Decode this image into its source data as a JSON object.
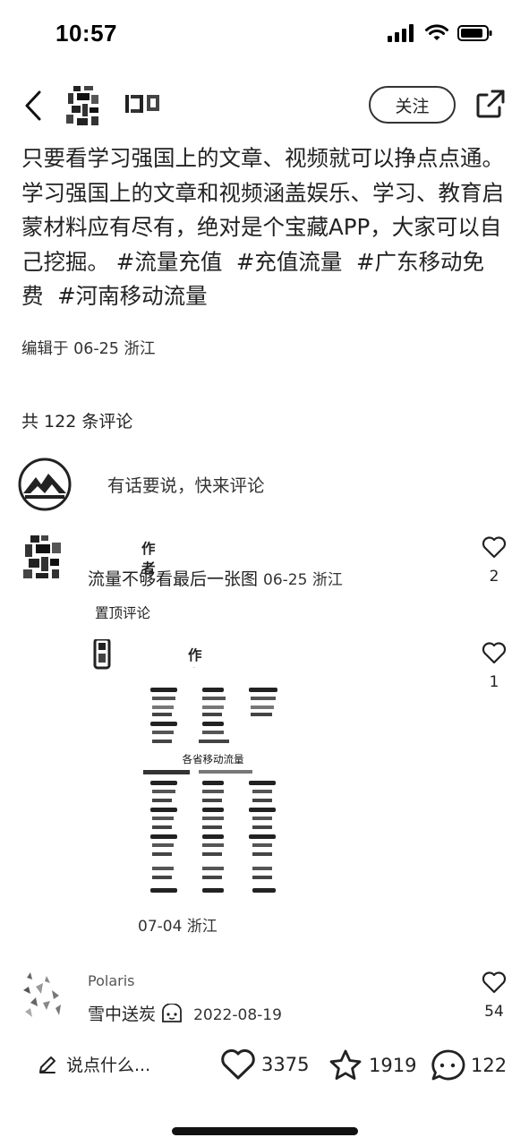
{
  "status": {
    "time": "10:57"
  },
  "nav": {
    "author_name": "",
    "follow_label": "关注"
  },
  "post": {
    "text": "只要看学习强国上的文章、视频就可以挣点点通。学习强国上的文章和视频涵盖娱乐、学习、教育启蒙材料应有尽有，绝对是个宝藏APP，大家可以自己挖掘。",
    "tags": [
      "#流量充值",
      "#充值流量",
      "#广东移动免费",
      "#河南移动流量"
    ],
    "edit_meta": "编辑于 06-25 浙江"
  },
  "comments_header": {
    "count_text": "共 122 条评论"
  },
  "comment_input": {
    "placeholder": "有话要说，快来评论"
  },
  "comments": [
    {
      "name": "",
      "author_tag": "作者",
      "text": "流量不够看最后一张图",
      "time": "06-25 浙江",
      "likes": "2",
      "pinned_label": "置顶评论"
    },
    {
      "name": "",
      "author_tag": "作者",
      "image_title": "各省移动流量",
      "time": "07-04 浙江",
      "likes": "1"
    },
    {
      "name": "Polaris",
      "text": "雪中送炭",
      "time": "2022-08-19",
      "likes": "54"
    }
  ],
  "bottom_bar": {
    "say_label": "说点什么...",
    "likes": "3375",
    "favorites": "1919",
    "comments": "122"
  }
}
